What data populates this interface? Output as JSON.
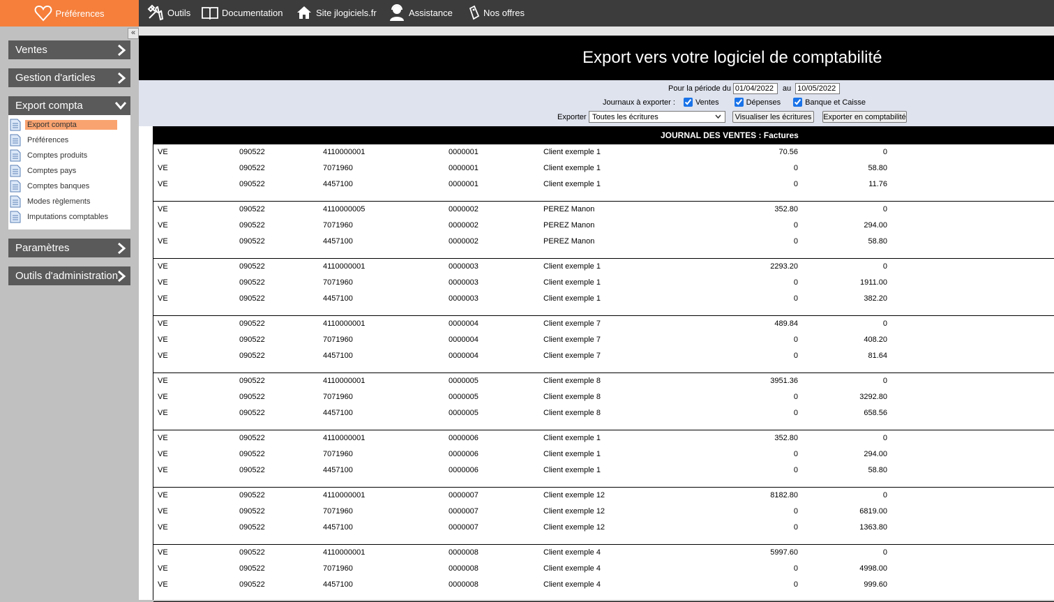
{
  "topbar": {
    "brand": "Préférences",
    "nav": [
      {
        "label": "Outils",
        "icon": "tools-icon"
      },
      {
        "label": "Documentation",
        "icon": "book-icon"
      },
      {
        "label": "Site jlogiciels.fr",
        "icon": "home-icon"
      },
      {
        "label": "Assistance",
        "icon": "support-icon"
      },
      {
        "label": "Nos offres",
        "icon": "tag-icon"
      }
    ]
  },
  "sidebar": {
    "collapse": "«",
    "sections": [
      "Ventes",
      "Gestion d'articles",
      "Export compta",
      "Paramètres",
      "Outils d'administration"
    ],
    "submenu": [
      "Export compta",
      "Préférences",
      "Comptes produits",
      "Comptes pays",
      "Comptes banques",
      "Modes règlements",
      "Imputations comptables"
    ]
  },
  "page": {
    "title": "Export vers votre logiciel de comptabilité",
    "period_label": "Pour la période du",
    "date_from": "01/04/2022",
    "au": "au",
    "date_to": "10/05/2022",
    "journaux_label": "Journaux à exporter :",
    "check_ventes": "Ventes",
    "check_depenses": "Dépenses",
    "check_banque": "Banque et Caisse",
    "exporter_label": "Exporter",
    "select_value": "Toutes les écritures",
    "btn_visualiser": "Visualiser les écritures",
    "btn_exporter": "Exporter en comptabilité"
  },
  "journal": {
    "header": "JOURNAL DES VENTES : Factures",
    "groups": [
      [
        [
          "VE",
          "090522",
          "4110000001",
          "0000001",
          "Client exemple 1",
          "70.56",
          "0"
        ],
        [
          "VE",
          "090522",
          "7071960",
          "0000001",
          "Client exemple 1",
          "0",
          "58.80"
        ],
        [
          "VE",
          "090522",
          "4457100",
          "0000001",
          "Client exemple 1",
          "0",
          "11.76"
        ]
      ],
      [
        [
          "VE",
          "090522",
          "4110000005",
          "0000002",
          "PEREZ Manon",
          "352.80",
          "0"
        ],
        [
          "VE",
          "090522",
          "7071960",
          "0000002",
          "PEREZ Manon",
          "0",
          "294.00"
        ],
        [
          "VE",
          "090522",
          "4457100",
          "0000002",
          "PEREZ Manon",
          "0",
          "58.80"
        ]
      ],
      [
        [
          "VE",
          "090522",
          "4110000001",
          "0000003",
          "Client exemple 1",
          "2293.20",
          "0"
        ],
        [
          "VE",
          "090522",
          "7071960",
          "0000003",
          "Client exemple 1",
          "0",
          "1911.00"
        ],
        [
          "VE",
          "090522",
          "4457100",
          "0000003",
          "Client exemple 1",
          "0",
          "382.20"
        ]
      ],
      [
        [
          "VE",
          "090522",
          "4110000001",
          "0000004",
          "Client exemple 7",
          "489.84",
          "0"
        ],
        [
          "VE",
          "090522",
          "7071960",
          "0000004",
          "Client exemple 7",
          "0",
          "408.20"
        ],
        [
          "VE",
          "090522",
          "4457100",
          "0000004",
          "Client exemple 7",
          "0",
          "81.64"
        ]
      ],
      [
        [
          "VE",
          "090522",
          "4110000001",
          "0000005",
          "Client exemple 8",
          "3951.36",
          "0"
        ],
        [
          "VE",
          "090522",
          "7071960",
          "0000005",
          "Client exemple 8",
          "0",
          "3292.80"
        ],
        [
          "VE",
          "090522",
          "4457100",
          "0000005",
          "Client exemple 8",
          "0",
          "658.56"
        ]
      ],
      [
        [
          "VE",
          "090522",
          "4110000001",
          "0000006",
          "Client exemple 1",
          "352.80",
          "0"
        ],
        [
          "VE",
          "090522",
          "7071960",
          "0000006",
          "Client exemple 1",
          "0",
          "294.00"
        ],
        [
          "VE",
          "090522",
          "4457100",
          "0000006",
          "Client exemple 1",
          "0",
          "58.80"
        ]
      ],
      [
        [
          "VE",
          "090522",
          "4110000001",
          "0000007",
          "Client exemple 12",
          "8182.80",
          "0"
        ],
        [
          "VE",
          "090522",
          "7071960",
          "0000007",
          "Client exemple 12",
          "0",
          "6819.00"
        ],
        [
          "VE",
          "090522",
          "4457100",
          "0000007",
          "Client exemple 12",
          "0",
          "1363.80"
        ]
      ],
      [
        [
          "VE",
          "090522",
          "4110000001",
          "0000008",
          "Client exemple 4",
          "5997.60",
          "0"
        ],
        [
          "VE",
          "090522",
          "7071960",
          "0000008",
          "Client exemple 4",
          "0",
          "4998.00"
        ],
        [
          "VE",
          "090522",
          "4457100",
          "0000008",
          "Client exemple 4",
          "0",
          "999.60"
        ]
      ]
    ]
  }
}
